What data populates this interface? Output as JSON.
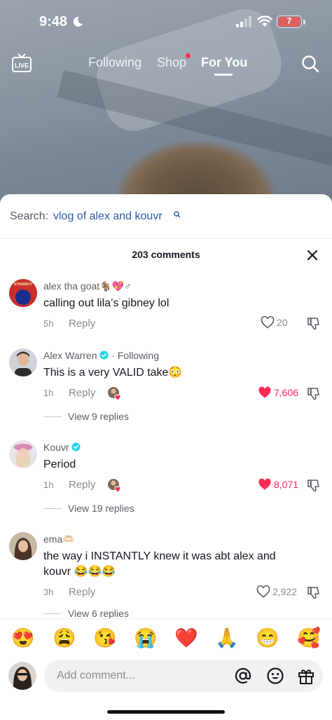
{
  "status_bar": {
    "time": "9:48",
    "battery": "7"
  },
  "top_nav": {
    "live_label": "LIVE",
    "tabs": [
      {
        "label": "Following"
      },
      {
        "label": "Shop"
      },
      {
        "label": "For You"
      }
    ],
    "active_tab": "For You"
  },
  "search_suggestion": {
    "prefix": "Search:",
    "query": "vlog of alex and kouvr"
  },
  "comments_header": {
    "count_label": "203 comments"
  },
  "comments": [
    {
      "user": "alex  tha  goat🐐💖♂",
      "text": "calling out lila’s gibney lol",
      "time": "5h",
      "reply_label": "Reply",
      "likes": "20",
      "liked": false,
      "avatar_label": "STARBOY"
    },
    {
      "user": "Alex Warren",
      "badge": "verified",
      "following": "· Following",
      "text": "This is a very VALID take😳",
      "time": "1h",
      "reply_label": "Reply",
      "likes": "7,606",
      "liked": true,
      "view_replies": "View 9 replies"
    },
    {
      "user": "Kouvr",
      "badge": "verified",
      "text": "Period",
      "time": "1h",
      "reply_label": "Reply",
      "likes": "8,071",
      "liked": true,
      "view_replies": "View 19 replies"
    },
    {
      "user": "ema🫶🏻",
      "text": "the way i INSTANTLY knew it was abt alex and kouvr 😂😂😂",
      "time": "3h",
      "reply_label": "Reply",
      "likes": "2,922",
      "liked": false,
      "view_replies": "View 6 replies"
    }
  ],
  "quick_emojis": [
    "😍",
    "😩",
    "😘",
    "😭",
    "❤️",
    "🙏",
    "😁",
    "🥰"
  ],
  "comment_input": {
    "placeholder": "Add comment..."
  },
  "colors": {
    "accent_red": "#fe2c55",
    "link_blue": "#2b5ca8",
    "verified_blue": "#20d5ec"
  }
}
